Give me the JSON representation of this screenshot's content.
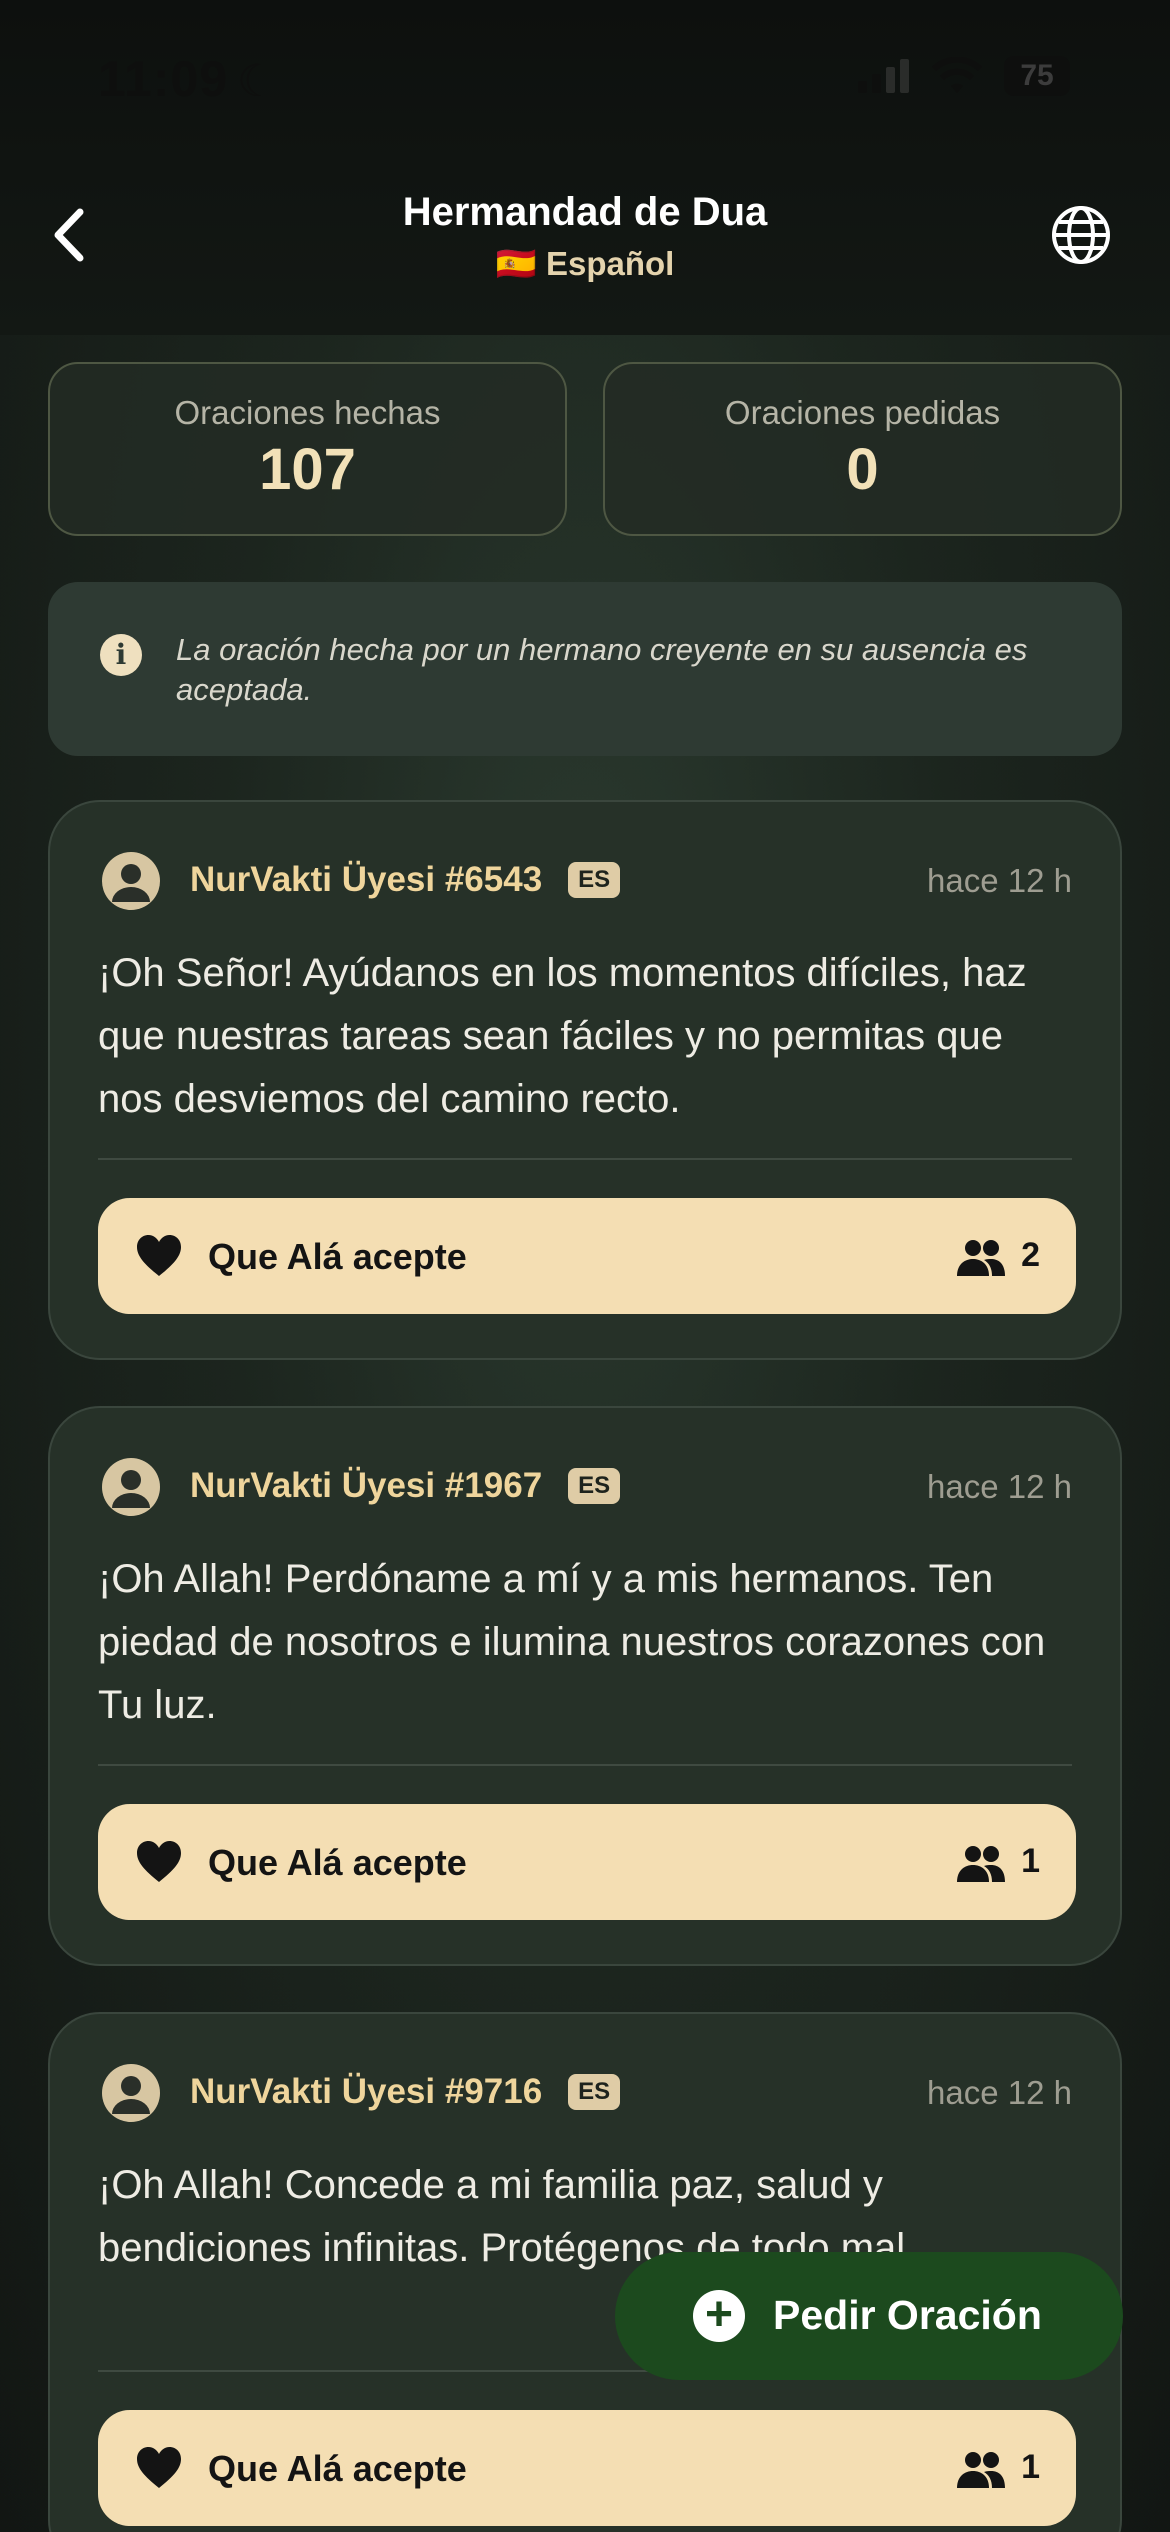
{
  "status_bar": {
    "time": "11:09",
    "battery": "75"
  },
  "header": {
    "title": "Hermandad de Dua",
    "language_flag": "🇪🇸",
    "language": "Español"
  },
  "stats": {
    "made_label": "Oraciones hechas",
    "made_value": "107",
    "requested_label": "Oraciones pedidas",
    "requested_value": "0"
  },
  "info": {
    "text": "La oración hecha por un hermano creyente en su ausencia es aceptada."
  },
  "prayers": [
    {
      "user": "NurVakti Üyesi #6543",
      "lang": "ES",
      "time": "hace 12 h",
      "text": "¡Oh Señor! Ayúdanos en los momentos difíciles, haz que nuestras tareas sean fáciles y no permitas que nos desviemos del camino recto.",
      "button": "Que Alá acepte",
      "count": "2"
    },
    {
      "user": "NurVakti Üyesi #1967",
      "lang": "ES",
      "time": "hace 12 h",
      "text": "¡Oh Allah! Perdóname a mí y a mis hermanos. Ten piedad de nosotros e ilumina nuestros corazones con Tu luz.",
      "button": "Que Alá acepte",
      "count": "1"
    },
    {
      "user": "NurVakti Üyesi #9716",
      "lang": "ES",
      "time": "hace 12 h",
      "text": "¡Oh Allah! Concede a mi familia paz, salud y bendiciones infinitas. Protégenos de todo mal.",
      "button": "Que Alá acepte",
      "count": "1"
    }
  ],
  "fab": {
    "label": "Pedir Oración"
  },
  "colors": {
    "accent": "#f4deb3",
    "fab": "#1c4a1e",
    "username": "#efd59c"
  }
}
